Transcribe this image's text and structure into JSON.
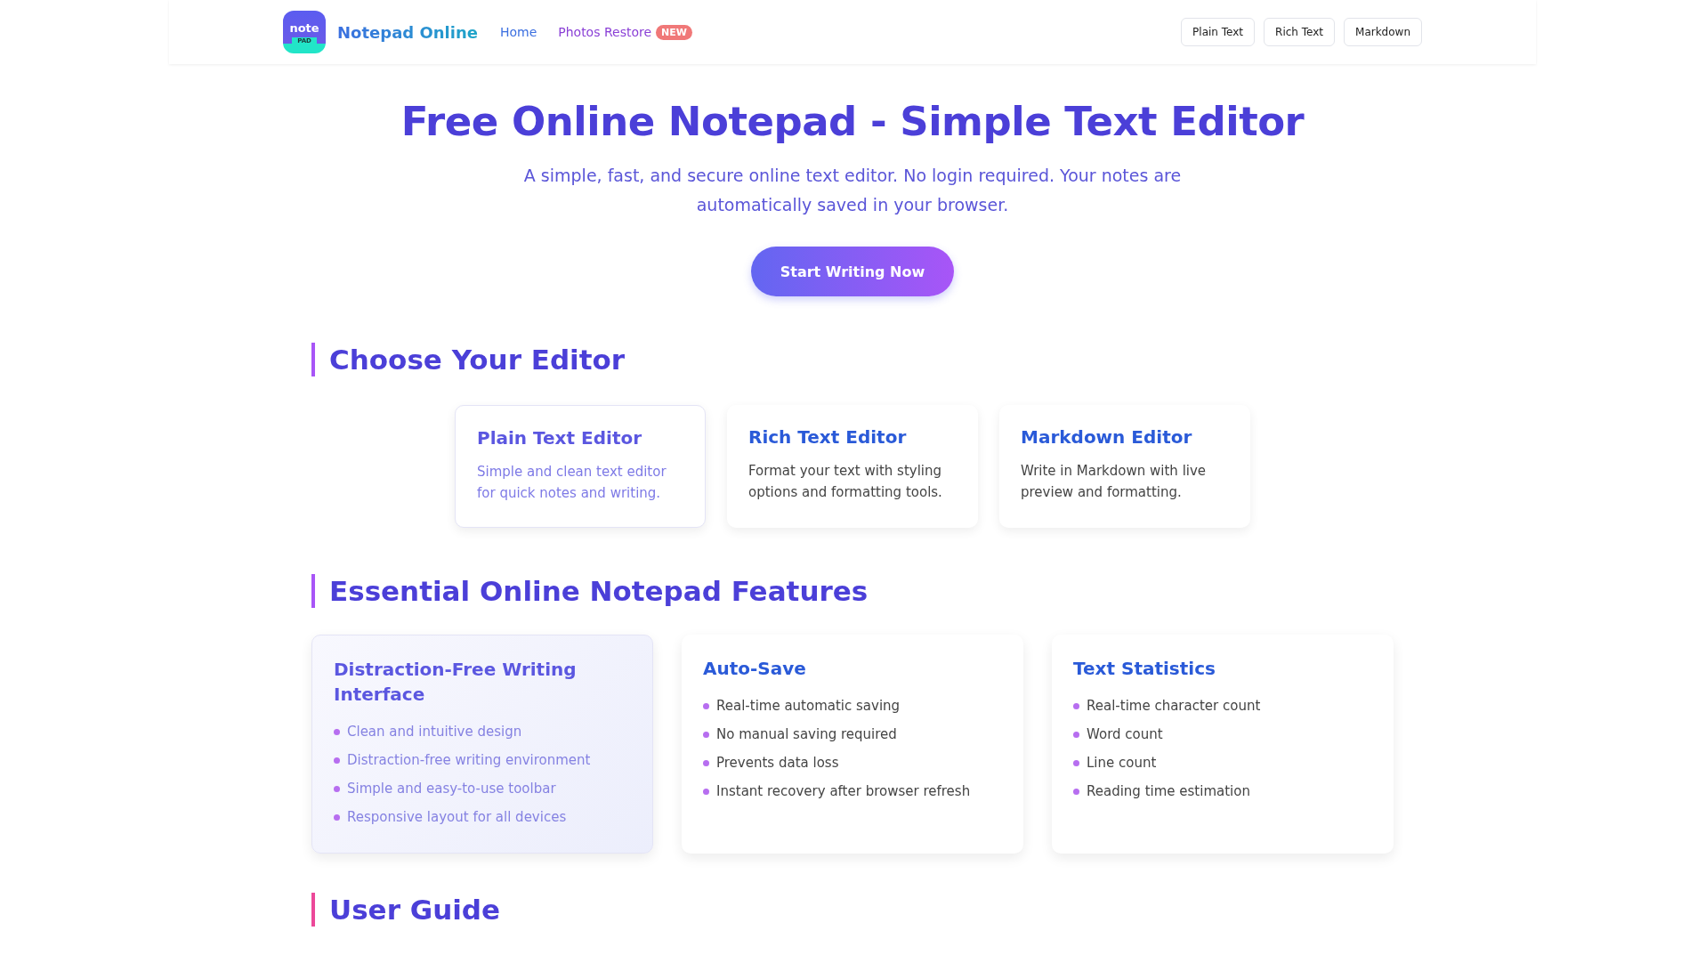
{
  "header": {
    "logo": {
      "word": "note",
      "sub": "PAD"
    },
    "brand": "Notepad Online",
    "nav": [
      {
        "label": "Home",
        "kind": "plain"
      },
      {
        "label": "Photos Restore",
        "kind": "new",
        "badge": "NEW"
      }
    ],
    "editor_buttons": [
      "Plain Text",
      "Rich Text",
      "Markdown"
    ]
  },
  "hero": {
    "title": "Free Online Notepad - Simple Text Editor",
    "subtitle": "A simple, fast, and secure online text editor. No login required. Your notes are automatically saved in your browser.",
    "cta": "Start Writing Now"
  },
  "editors": {
    "heading": "Choose Your Editor",
    "cards": [
      {
        "title": "Plain Text Editor",
        "text": "Simple and clean text editor for quick notes and writing.",
        "selected": true
      },
      {
        "title": "Rich Text Editor",
        "text": "Format your text with styling options and formatting tools.",
        "selected": false
      },
      {
        "title": "Markdown Editor",
        "text": "Write in Markdown with live preview and formatting.",
        "selected": false
      }
    ]
  },
  "features": {
    "heading": "Essential Online Notepad Features",
    "cards": [
      {
        "title": "Distraction-Free Writing Interface",
        "items": [
          "Clean and intuitive design",
          "Distraction-free writing environment",
          "Simple and easy-to-use toolbar",
          "Responsive layout for all devices"
        ],
        "selected": true
      },
      {
        "title": "Auto-Save",
        "items": [
          "Real-time automatic saving",
          "No manual saving required",
          "Prevents data loss",
          "Instant recovery after browser refresh"
        ],
        "selected": false
      },
      {
        "title": "Text Statistics",
        "items": [
          "Real-time character count",
          "Word count",
          "Line count",
          "Reading time estimation"
        ],
        "selected": false
      }
    ]
  },
  "guide": {
    "heading": "User Guide"
  }
}
